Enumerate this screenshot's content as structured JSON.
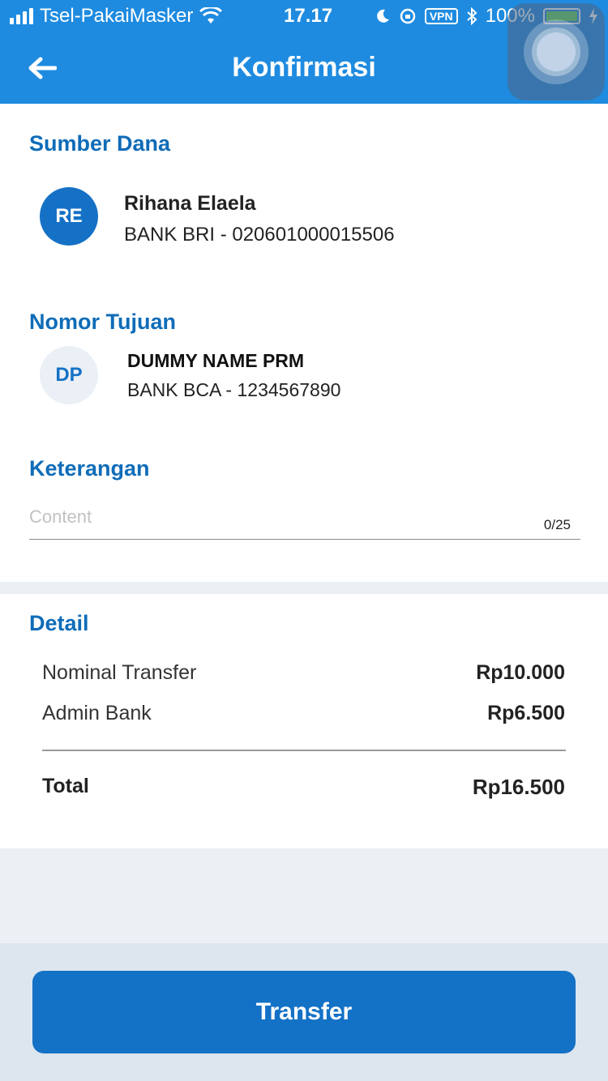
{
  "statusbar": {
    "carrier": "Tsel-PakaiMasker",
    "time": "17.17",
    "vpn": "VPN",
    "battery": "100%"
  },
  "header": {
    "title": "Konfirmasi"
  },
  "source": {
    "section_title": "Sumber Dana",
    "initials": "RE",
    "name": "Rihana Elaela",
    "account": "BANK BRI - 020601000015506"
  },
  "destination": {
    "section_title": "Nomor Tujuan",
    "initials": "DP",
    "name": "DUMMY NAME PRM",
    "account": "BANK BCA - 1234567890"
  },
  "note": {
    "section_title": "Keterangan",
    "placeholder": "Content",
    "counter": "0/25"
  },
  "detail": {
    "section_title": "Detail",
    "rows": [
      {
        "label": "Nominal Transfer",
        "value": "Rp10.000"
      },
      {
        "label": "Admin Bank",
        "value": "Rp6.500"
      }
    ],
    "total_label": "Total",
    "total_value": "Rp16.500"
  },
  "footer": {
    "button_label": "Transfer"
  },
  "colors": {
    "header": "#1e8be0",
    "accent": "#1371c6",
    "section_title": "#0f6cb8"
  }
}
